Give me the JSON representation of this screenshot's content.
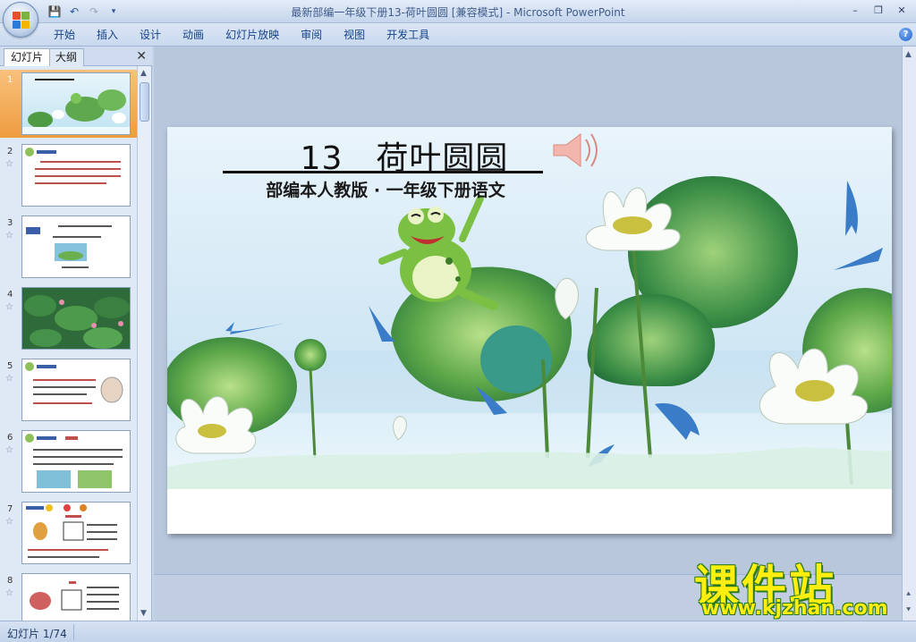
{
  "window": {
    "title": "最新部编一年级下册13-荷叶圆圆 [兼容模式] - Microsoft PowerPoint"
  },
  "quick_access": {
    "icons": [
      "save-icon",
      "undo-icon",
      "redo-icon",
      "customize-icon"
    ]
  },
  "ribbon": {
    "tabs": [
      "开始",
      "插入",
      "设计",
      "动画",
      "幻灯片放映",
      "审阅",
      "视图",
      "开发工具"
    ]
  },
  "left_panel": {
    "tabs": [
      "幻灯片",
      "大纲"
    ],
    "active_tab": "幻灯片",
    "slides": [
      {
        "number": "1",
        "selected": true
      },
      {
        "number": "2"
      },
      {
        "number": "3"
      },
      {
        "number": "4"
      },
      {
        "number": "5"
      },
      {
        "number": "6"
      },
      {
        "number": "7"
      },
      {
        "number": "8"
      }
    ]
  },
  "slide": {
    "title": "13　荷叶圆圆",
    "subtitle": "部编本人教版 · 一年级下册语文"
  },
  "watermark": {
    "cn": "课件站",
    "url": "www.kjzhan.com"
  },
  "status": {
    "slide_counter": "幻灯片 1/74"
  },
  "colors": {
    "ribbon_text": "#15428b",
    "selected_thumb": "#ef9c3f",
    "watermark_yellow": "#ffee10"
  }
}
